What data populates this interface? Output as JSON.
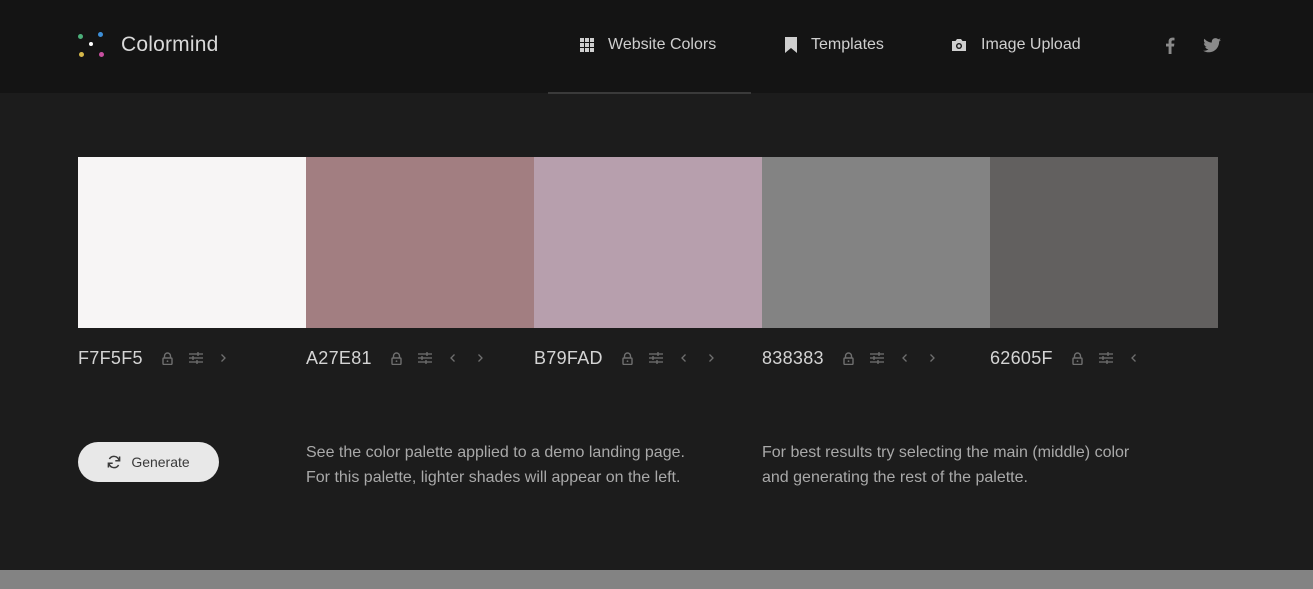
{
  "header": {
    "brand": "Colormind",
    "nav": [
      {
        "label": "Website Colors",
        "icon": "grid-icon"
      },
      {
        "label": "Templates",
        "icon": "bookmark-icon"
      },
      {
        "label": "Image Upload",
        "icon": "camera-icon"
      }
    ],
    "social": [
      {
        "icon": "facebook-icon"
      },
      {
        "icon": "twitter-icon"
      }
    ]
  },
  "palette": [
    {
      "hex": "F7F5F5",
      "color": "#F7F5F5"
    },
    {
      "hex": "A27E81",
      "color": "#A27E81"
    },
    {
      "hex": "B79FAD",
      "color": "#B79FAD"
    },
    {
      "hex": "838383",
      "color": "#838383"
    },
    {
      "hex": "62605F",
      "color": "#62605F"
    }
  ],
  "generate_label": "Generate",
  "info": {
    "left_line1": "See the color palette applied to a demo landing page.",
    "left_line2": "For this palette, lighter shades will appear on the left.",
    "right_line1": "For best results try selecting the main (middle) color",
    "right_line2": "and generating the rest of the palette."
  },
  "colors": {
    "header_bg": "#141414",
    "page_bg": "#1c1c1c",
    "footer_band": "#838383"
  }
}
